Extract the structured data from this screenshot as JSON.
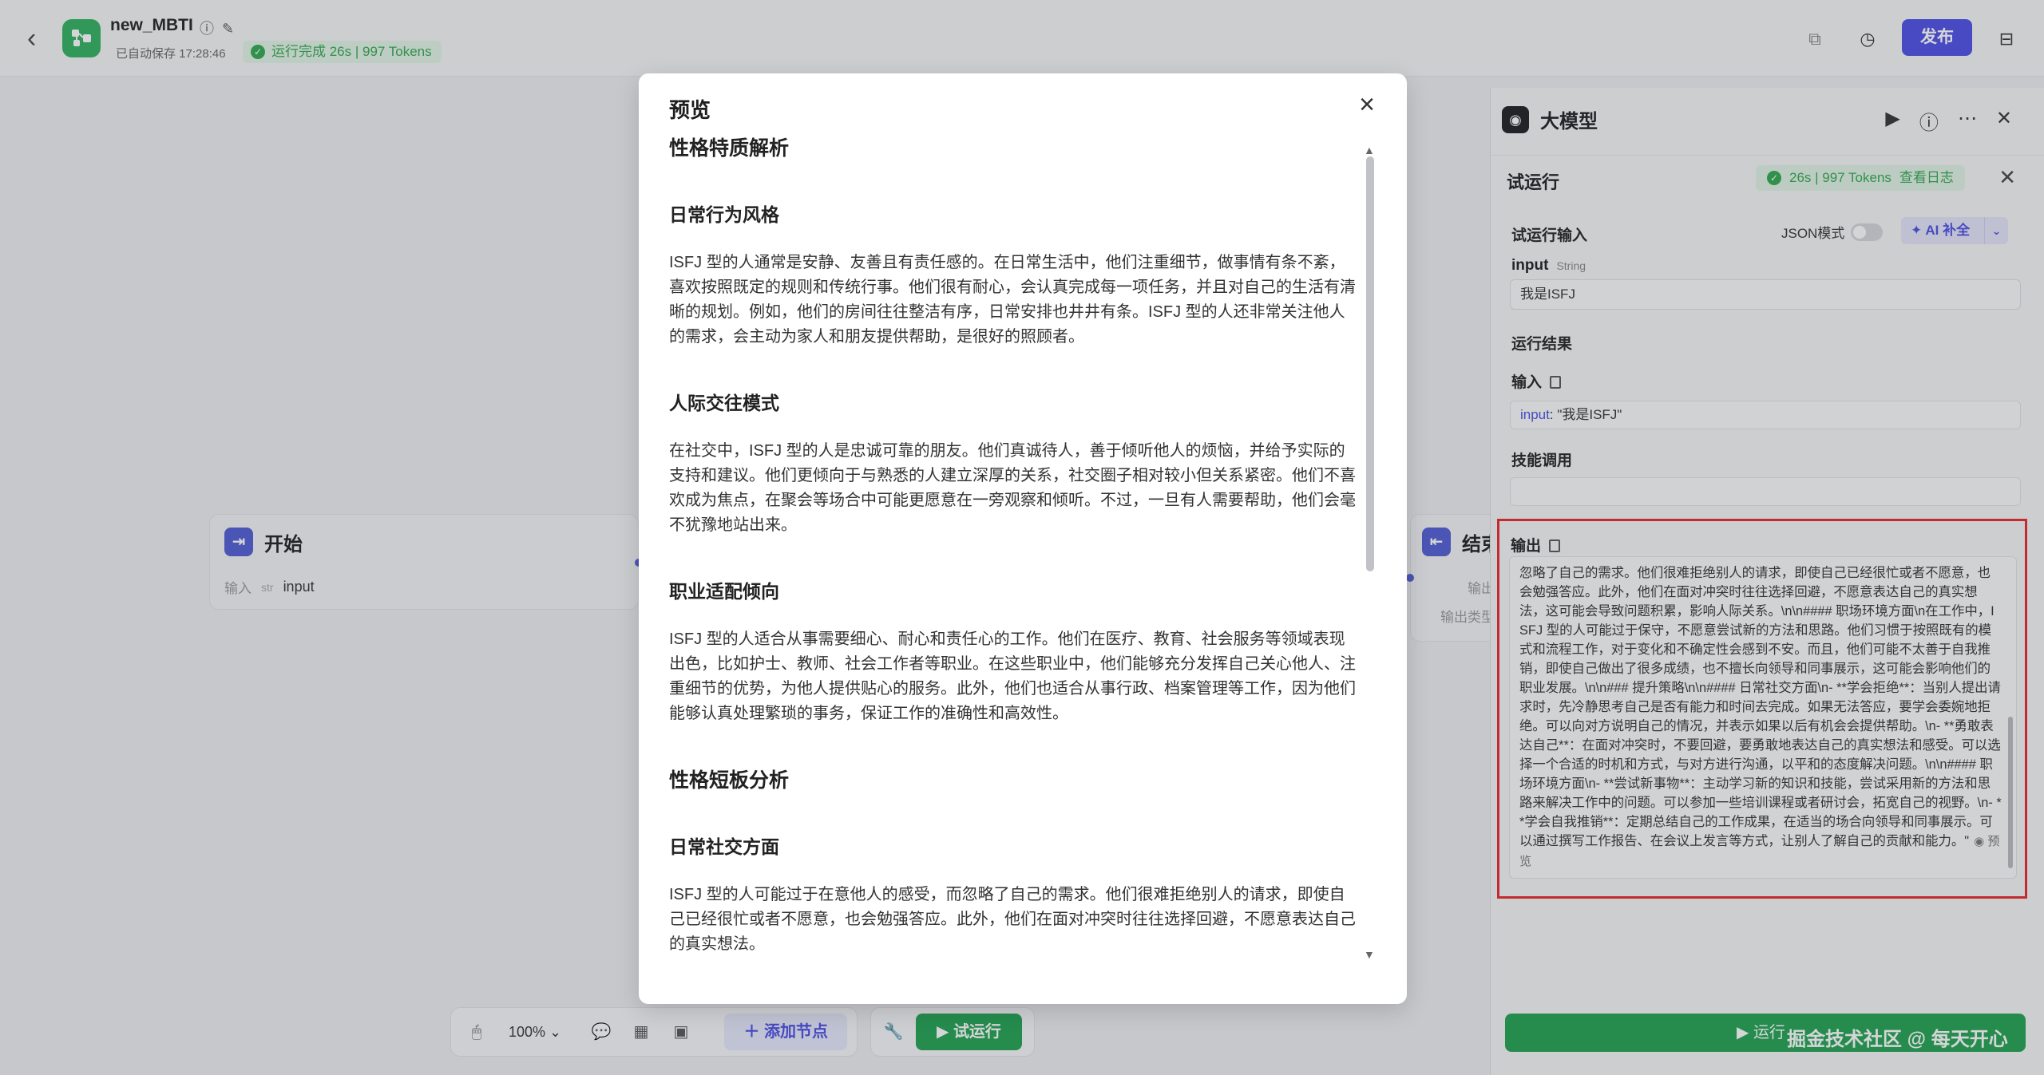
{
  "topbar": {
    "title": "new_MBTI",
    "autosave": "已自动保存 17:28:46",
    "run_status": "运行完成 26s | 997 Tokens",
    "publish": "发布"
  },
  "canvas": {
    "start_node": {
      "title": "开始",
      "row_label": "输入",
      "type_tag": "str",
      "value": "input"
    },
    "end_node": {
      "title": "结束",
      "row1": "输出",
      "row2": "输出类型"
    }
  },
  "bottombar": {
    "zoom": "100%",
    "add_node": "添加节点",
    "trial_run": "试运行"
  },
  "modal": {
    "title": "预览",
    "sections": [
      {
        "heading": "性格特质解析"
      },
      {
        "subheading": "日常行为风格",
        "text": "ISFJ 型的人通常是安静、友善且有责任感的。在日常生活中，他们注重细节，做事情有条不紊，喜欢按照既定的规则和传统行事。他们很有耐心，会认真完成每一项任务，并且对自己的生活有清晰的规划。例如，他们的房间往往整洁有序，日常安排也井井有条。ISFJ 型的人还非常关注他人的需求，会主动为家人和朋友提供帮助，是很好的照顾者。"
      },
      {
        "subheading": "人际交往模式",
        "text": "在社交中，ISFJ 型的人是忠诚可靠的朋友。他们真诚待人，善于倾听他人的烦恼，并给予实际的支持和建议。他们更倾向于与熟悉的人建立深厚的关系，社交圈子相对较小但关系紧密。他们不喜欢成为焦点，在聚会等场合中可能更愿意在一旁观察和倾听。不过，一旦有人需要帮助，他们会毫不犹豫地站出来。"
      },
      {
        "subheading": "职业适配倾向",
        "text": "ISFJ 型的人适合从事需要细心、耐心和责任心的工作。他们在医疗、教育、社会服务等领域表现出色，比如护士、教师、社会工作者等职业。在这些职业中，他们能够充分发挥自己关心他人、注重细节的优势，为他人提供贴心的服务。此外，他们也适合从事行政、档案管理等工作，因为他们能够认真处理繁琐的事务，保证工作的准确性和高效性。"
      },
      {
        "heading": "性格短板分析"
      },
      {
        "subheading": "日常社交方面",
        "text": "ISFJ 型的人可能过于在意他人的感受，而忽略了自己的需求。他们很难拒绝别人的请求，即使自己已经很忙或者不愿意，也会勉强答应。此外，他们在面对冲突时往往选择回避，不愿意表达自己的真实想法。"
      }
    ]
  },
  "panel": {
    "title": "大模型",
    "trial": {
      "label": "试运行",
      "tokens": "26s | 997 Tokens",
      "view_log": "查看日志"
    },
    "input_section": {
      "title": "试运行输入",
      "json_mode": "JSON模式",
      "ai_fill": "AI 补全",
      "field_name": "input",
      "field_type": "String",
      "field_value": "我是ISFJ"
    },
    "result_section": {
      "title": "运行结果",
      "input_label": "输入",
      "input_key": "input",
      "input_value": ": \"我是ISFJ\"",
      "skill_label": "技能调用",
      "output_label": "输出",
      "output_text": "忽略了自己的需求。他们很难拒绝别人的请求，即使自己已经很忙或者不愿意，也会勉强答应。此外，他们在面对冲突时往往选择回避，不愿意表达自己的真实想法，这可能会导致问题积累，影响人际关系。\\n\\n#### 职场环境方面\\n在工作中，ISFJ 型的人可能过于保守，不愿意尝试新的方法和思路。他们习惯于按照既有的模式和流程工作，对于变化和不确定性会感到不安。而且，他们可能不太善于自我推销，即使自己做出了很多成绩，也不擅长向领导和同事展示，这可能会影响他们的职业发展。\\n\\n### 提升策略\\n\\n#### 日常社交方面\\n- **学会拒绝**：当别人提出请求时，先冷静思考自己是否有能力和时间去完成。如果无法答应，要学会委婉地拒绝。可以向对方说明自己的情况，并表示如果以后有机会会提供帮助。\\n- **勇敢表达自己**：在面对冲突时，不要回避，要勇敢地表达自己的真实想法和感受。可以选择一个合适的时机和方式，与对方进行沟通，以平和的态度解决问题。\\n\\n#### 职场环境方面\\n- **尝试新事物**：主动学习新的知识和技能，尝试采用新的方法和思路来解决工作中的问题。可以参加一些培训课程或者研讨会，拓宽自己的视野。\\n- **学会自我推销**：定期总结自己的工作成果，在适当的场合向领导和同事展示。可以通过撰写工作报告、在会议上发言等方式，让别人了解自己的贡献和能力。\"",
      "preview": "预览"
    },
    "run_button": "运行"
  },
  "watermark": "掘金技术社区 @ 每天开心"
}
